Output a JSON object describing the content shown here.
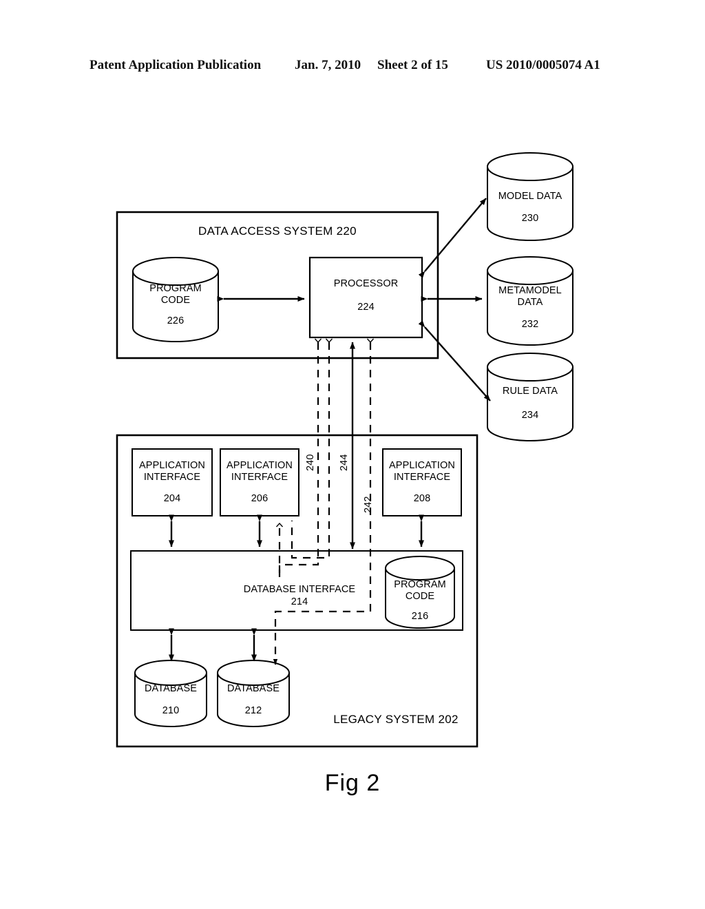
{
  "header": {
    "publication": "Patent Application Publication",
    "date": "Jan. 7, 2010",
    "sheet": "Sheet 2 of 15",
    "patent_number": "US 2010/0005074 A1"
  },
  "figure": {
    "caption": "Fig 2",
    "type": "patent-block-diagram",
    "stroke_color": "#000000",
    "background_color": "#ffffff"
  },
  "diagram": {
    "data_access_system": {
      "title": "DATA ACCESS SYSTEM 220",
      "program_code": {
        "line1": "PROGRAM",
        "line2": "CODE",
        "ref": "226"
      },
      "processor": {
        "line1": "PROCESSOR",
        "ref": "224"
      }
    },
    "stores": [
      {
        "line1": "MODEL DATA",
        "line2": "",
        "ref": "230"
      },
      {
        "line1": "METAMODEL",
        "line2": "DATA",
        "ref": "232"
      },
      {
        "line1": "RULE DATA",
        "line2": "",
        "ref": "234"
      }
    ],
    "legacy_system": {
      "title": "LEGACY SYSTEM 202",
      "application_interfaces": [
        {
          "line1": "APPLICATION",
          "line2": "INTERFACE",
          "ref": "204"
        },
        {
          "line1": "APPLICATION",
          "line2": "INTERFACE",
          "ref": "206"
        },
        {
          "line1": "APPLICATION",
          "line2": "INTERFACE",
          "ref": "208"
        }
      ],
      "database_interface": {
        "line1": "DATABASE INTERFACE",
        "ref": "214"
      },
      "program_code": {
        "line1": "PROGRAM",
        "line2": "CODE",
        "ref": "216"
      },
      "databases": [
        {
          "line1": "DATABASE",
          "ref": "210"
        },
        {
          "line1": "DATABASE",
          "ref": "212"
        }
      ]
    },
    "connector_labels": [
      {
        "ref": "240"
      },
      {
        "ref": "244"
      },
      {
        "ref": "242"
      }
    ]
  }
}
